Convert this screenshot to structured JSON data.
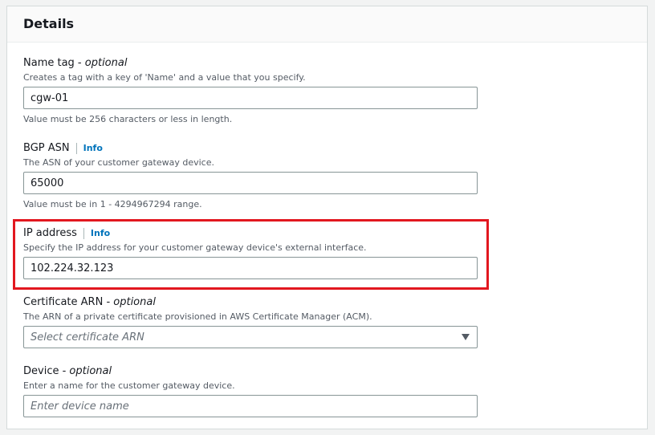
{
  "panel": {
    "title": "Details"
  },
  "fields": {
    "name_tag": {
      "label": "Name tag - ",
      "label_suffix": "optional",
      "description": "Creates a tag with a key of 'Name' and a value that you specify.",
      "value": "cgw-01",
      "constraint": "Value must be 256 characters or less in length."
    },
    "bgp_asn": {
      "label": "BGP ASN",
      "info": "Info",
      "description": "The ASN of your customer gateway device.",
      "value": "65000",
      "constraint": "Value must be in 1 - 4294967294 range."
    },
    "ip_address": {
      "label": "IP address",
      "info": "Info",
      "description": "Specify the IP address for your customer gateway device's external interface.",
      "value": "102.224.32.123"
    },
    "certificate_arn": {
      "label": "Certificate ARN - ",
      "label_suffix": "optional",
      "description": "The ARN of a private certificate provisioned in AWS Certificate Manager (ACM).",
      "placeholder": "Select certificate ARN"
    },
    "device": {
      "label": "Device - ",
      "label_suffix": "optional",
      "description": "Enter a name for the customer gateway device.",
      "placeholder": "Enter device name"
    }
  },
  "colors": {
    "highlight": "#e2171f",
    "link": "#0073bb",
    "border": "#879596"
  },
  "icons": {
    "dropdown": "caret-down-icon"
  }
}
